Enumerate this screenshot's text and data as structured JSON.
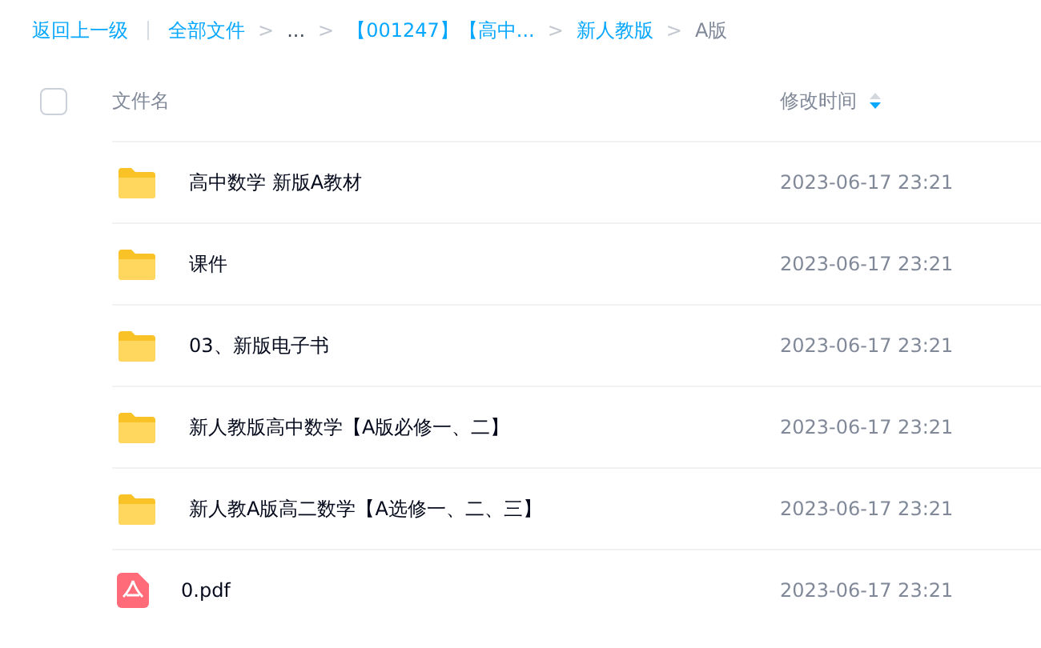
{
  "breadcrumb": {
    "back": "返回上一级",
    "items": [
      {
        "label": "全部文件",
        "kind": "link"
      },
      {
        "label": "...",
        "kind": "text"
      },
      {
        "label": "【001247】【高中...",
        "kind": "link"
      },
      {
        "label": "新人教版",
        "kind": "link"
      },
      {
        "label": "A版",
        "kind": "current"
      }
    ],
    "separator": ">"
  },
  "table": {
    "columns": [
      "文件名",
      "修改时间"
    ],
    "select_all": {
      "checked": false
    },
    "rows": [
      {
        "kind": "folder",
        "name": "高中数学 新版A教材",
        "modified": "2023-06-17 23:21"
      },
      {
        "kind": "folder",
        "name": "课件",
        "modified": "2023-06-17 23:21"
      },
      {
        "kind": "folder",
        "name": "03、新版电子书",
        "modified": "2023-06-17 23:21"
      },
      {
        "kind": "folder",
        "name": "新人教版高中数学【A版必修一、二】",
        "modified": "2023-06-17 23:21"
      },
      {
        "kind": "folder",
        "name": "新人教A版高二数学【A选修一、二、三】",
        "modified": "2023-06-17 23:21"
      },
      {
        "kind": "pdf",
        "name": "0.pdf",
        "modified": "2023-06-17 23:21"
      }
    ]
  }
}
